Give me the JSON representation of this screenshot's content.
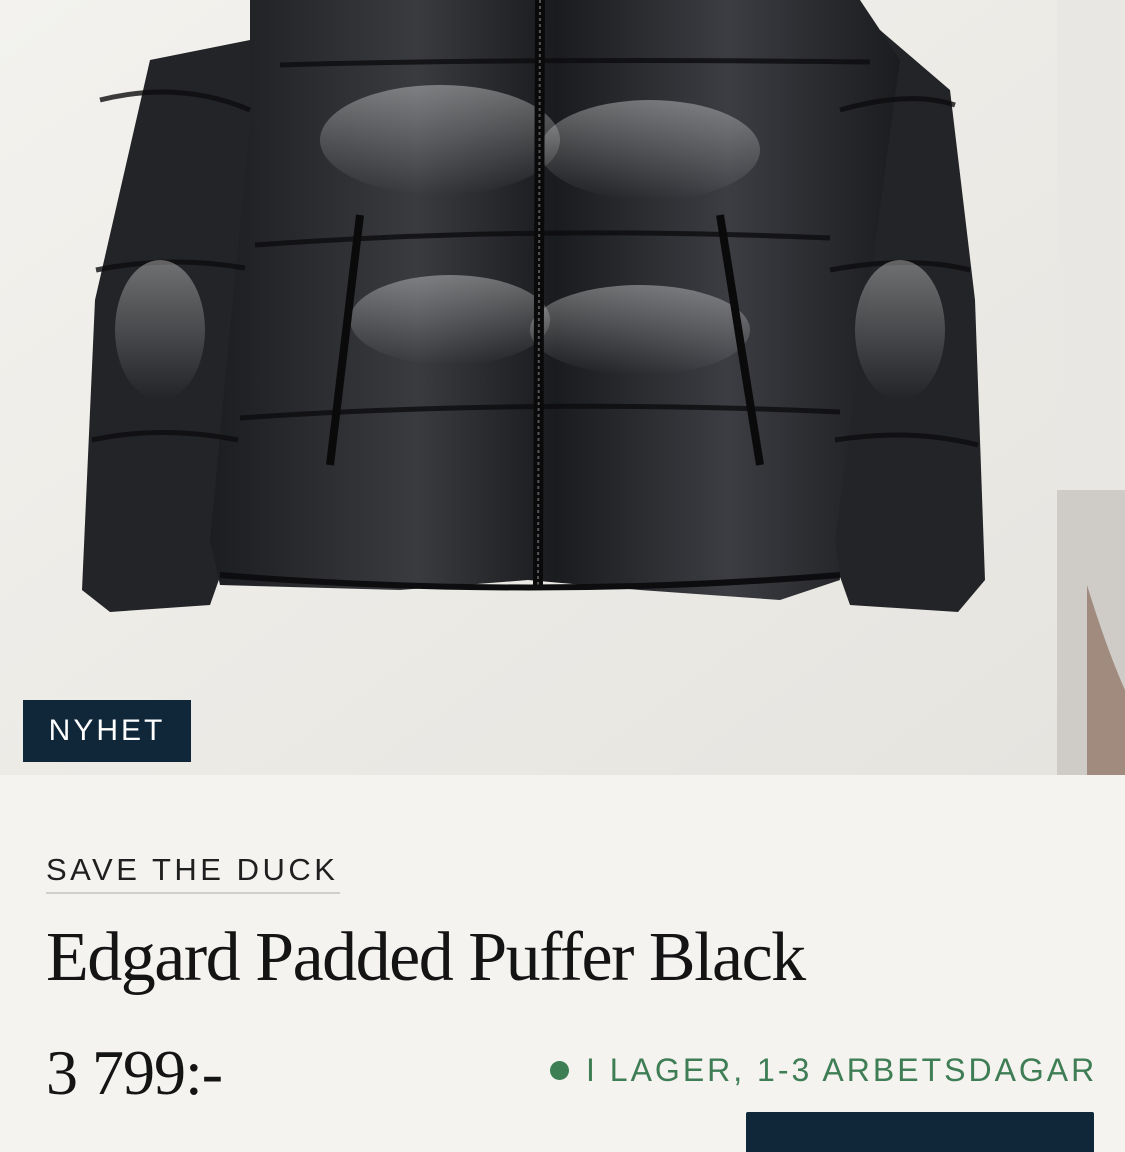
{
  "product": {
    "badge": "NYHET",
    "brand": "SAVE THE DUCK",
    "title": "Edgard Padded Puffer Black",
    "price": "3 799:-",
    "stock_status": "I LAGER, 1-3 ARBETSDAGAR"
  },
  "colors": {
    "navy": "#10273a",
    "stock_green": "#3d7f52"
  }
}
